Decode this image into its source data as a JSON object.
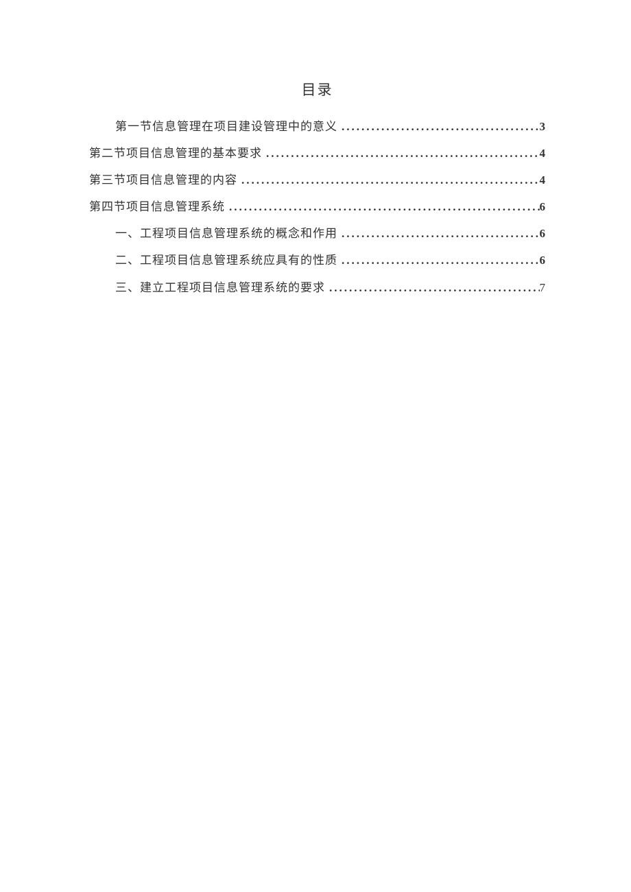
{
  "title": "目录",
  "entries": [
    {
      "label": "第一节信息管理在项目建设管理中的意义",
      "page": "3",
      "indent": 1,
      "bold_page": true
    },
    {
      "label": "第二节项目信息管理的基本要求",
      "page": "4",
      "indent": 0,
      "bold_page": true
    },
    {
      "label": "第三节项目信息管理的内容",
      "page": "4",
      "indent": 0,
      "bold_page": true
    },
    {
      "label": "第四节项目信息管理系统",
      "page": "6",
      "indent": 0,
      "bold_page": true
    },
    {
      "label": "一、工程项目信息管理系统的概念和作用",
      "page": "6",
      "indent": 1,
      "bold_page": true
    },
    {
      "label": "二、工程项目信息管理系统应具有的性质",
      "page": "6",
      "indent": 1,
      "bold_page": true
    },
    {
      "label": "三、建立工程项目信息管理系统的要求",
      "page": "7",
      "indent": 1,
      "bold_page": false
    }
  ]
}
